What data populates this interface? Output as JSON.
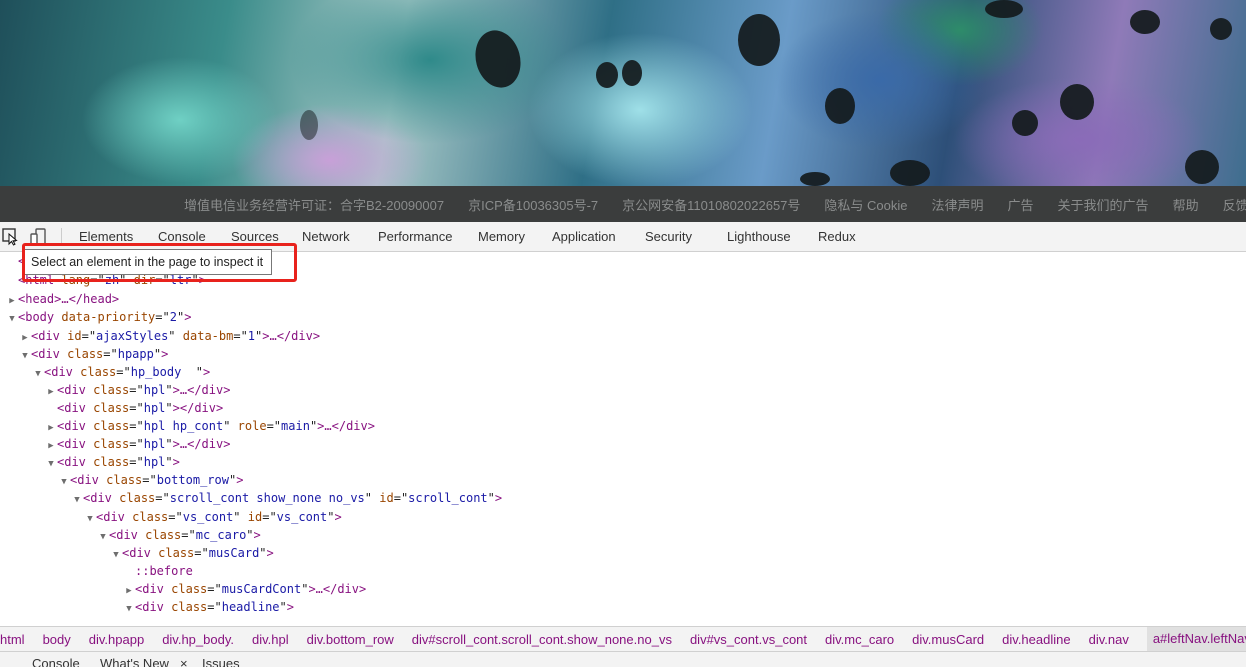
{
  "footer": {
    "links": [
      "增值电信业务经营许可证：合字B2-20090007",
      "京ICP备10036305号-7",
      "京公网安备11010802022657号",
      "隐私与 Cookie",
      "法律声明",
      "广告",
      "关于我们的广告",
      "帮助",
      "反馈"
    ]
  },
  "devtools": {
    "tabs": [
      "Elements",
      "Console",
      "Sources",
      "Network",
      "Performance",
      "Memory",
      "Application",
      "Security",
      "Lighthouse",
      "Redux"
    ],
    "tooltip": "Select an element in the page to inspect it",
    "dom": [
      {
        "indent": 0,
        "tri": "",
        "tag": "<",
        "attrs": [],
        "close": "",
        "partial": true
      },
      {
        "indent": 0,
        "tri": "",
        "tag": "html",
        "attrs": [
          [
            "lang",
            "zh"
          ],
          [
            "dir",
            "ltr"
          ]
        ],
        "close": ">"
      },
      {
        "indent": 0,
        "tri": "▶",
        "tag": "head",
        "attrs": [],
        "close": ">…</head>"
      },
      {
        "indent": 0,
        "tri": "▼",
        "tag": "body",
        "attrs": [
          [
            "data-priority",
            "2"
          ]
        ],
        "close": ">"
      },
      {
        "indent": 1,
        "tri": "▶",
        "tag": "div",
        "attrs": [
          [
            "id",
            "ajaxStyles"
          ],
          [
            "data-bm",
            "1"
          ]
        ],
        "close": ">…</div>"
      },
      {
        "indent": 1,
        "tri": "▼",
        "tag": "div",
        "attrs": [
          [
            "class",
            "hpapp"
          ]
        ],
        "close": ">"
      },
      {
        "indent": 2,
        "tri": "▼",
        "tag": "div",
        "attrs": [
          [
            "class",
            "hp_body  "
          ]
        ],
        "close": ">"
      },
      {
        "indent": 3,
        "tri": "▶",
        "tag": "div",
        "attrs": [
          [
            "class",
            "hpl"
          ]
        ],
        "close": ">…</div>"
      },
      {
        "indent": 3,
        "tri": "",
        "tag": "div",
        "attrs": [
          [
            "class",
            "hpl"
          ]
        ],
        "close": "></div>"
      },
      {
        "indent": 3,
        "tri": "▶",
        "tag": "div",
        "attrs": [
          [
            "class",
            "hpl hp_cont"
          ],
          [
            "role",
            "main"
          ]
        ],
        "close": ">…</div>"
      },
      {
        "indent": 3,
        "tri": "▶",
        "tag": "div",
        "attrs": [
          [
            "class",
            "hpl"
          ]
        ],
        "close": ">…</div>"
      },
      {
        "indent": 3,
        "tri": "▼",
        "tag": "div",
        "attrs": [
          [
            "class",
            "hpl"
          ]
        ],
        "close": ">"
      },
      {
        "indent": 4,
        "tri": "▼",
        "tag": "div",
        "attrs": [
          [
            "class",
            "bottom_row"
          ]
        ],
        "close": ">"
      },
      {
        "indent": 5,
        "tri": "▼",
        "tag": "div",
        "attrs": [
          [
            "class",
            "scroll_cont show_none no_vs"
          ],
          [
            "id",
            "scroll_cont"
          ]
        ],
        "close": ">"
      },
      {
        "indent": 6,
        "tri": "▼",
        "tag": "div",
        "attrs": [
          [
            "class",
            "vs_cont"
          ],
          [
            "id",
            "vs_cont"
          ]
        ],
        "close": ">"
      },
      {
        "indent": 7,
        "tri": "▼",
        "tag": "div",
        "attrs": [
          [
            "class",
            "mc_caro"
          ]
        ],
        "close": ">"
      },
      {
        "indent": 8,
        "tri": "▼",
        "tag": "div",
        "attrs": [
          [
            "class",
            "musCard"
          ]
        ],
        "close": ">"
      },
      {
        "indent": 9,
        "tri": "",
        "pseudo": "::before"
      },
      {
        "indent": 9,
        "tri": "▶",
        "tag": "div",
        "attrs": [
          [
            "class",
            "musCardCont"
          ]
        ],
        "close": ">…</div>"
      },
      {
        "indent": 9,
        "tri": "▼",
        "tag": "div",
        "attrs": [
          [
            "class",
            "headline"
          ]
        ],
        "close": ">"
      }
    ],
    "breadcrumbs": [
      "html",
      "body",
      "div.hpapp",
      "div.hp_body.",
      "div.hpl",
      "div.bottom_row",
      "div#scroll_cont.scroll_cont.show_none.no_vs",
      "div#vs_cont.vs_cont",
      "div.mc_caro",
      "div.musCard",
      "div.headline",
      "div.nav",
      "a#leftNav.leftNav."
    ],
    "drawer_tabs": [
      "Console",
      "What's New",
      "Issues"
    ]
  }
}
